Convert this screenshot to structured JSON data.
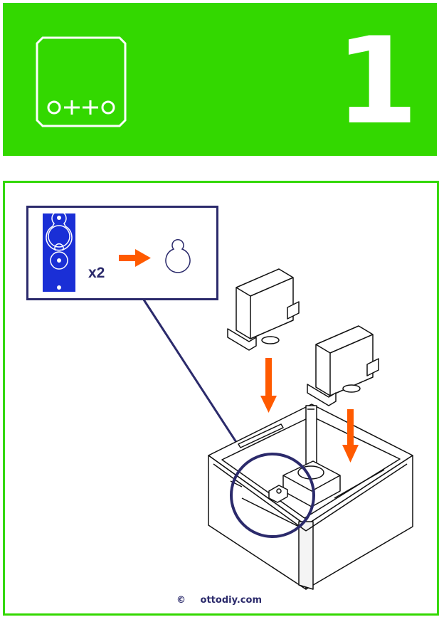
{
  "header": {
    "brand_text": "o+t+o",
    "step_number": "1",
    "background_color": "#33d800"
  },
  "inset": {
    "quantity": "x2",
    "arrow_color": "#ff5a00",
    "servo_color": "#1a2fd6",
    "border_color": "#2b2a6b"
  },
  "footer": {
    "copyright_symbol": "©",
    "site": "ottodiy.com"
  }
}
